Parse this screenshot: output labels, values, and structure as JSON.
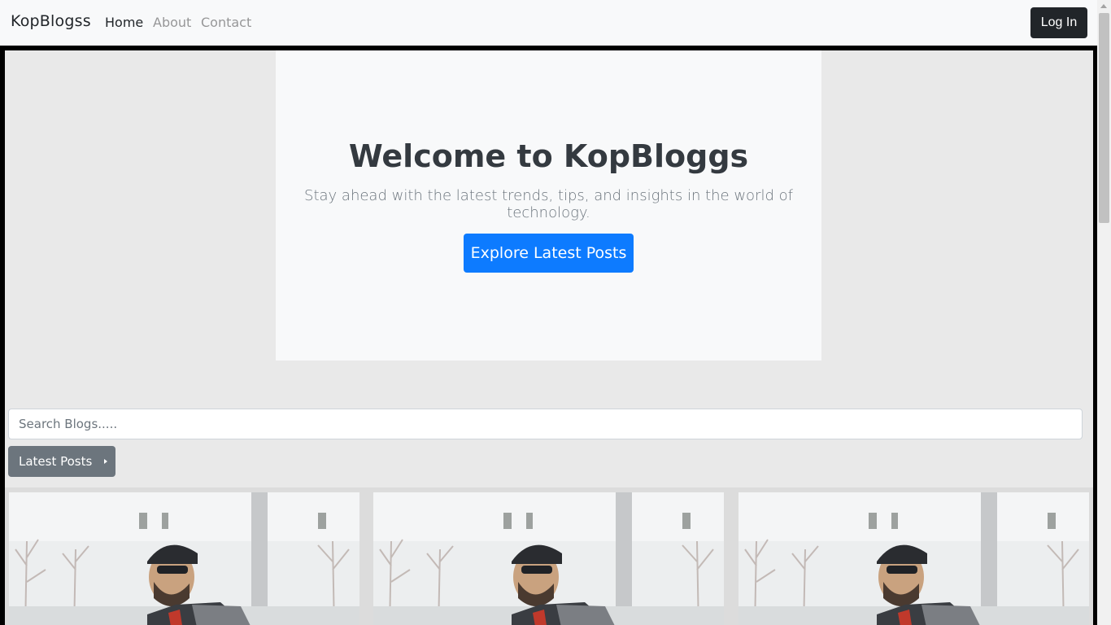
{
  "navbar": {
    "brand": "KopBlogss",
    "links": [
      {
        "label": "Home",
        "active": true
      },
      {
        "label": "About",
        "active": false
      },
      {
        "label": "Contact",
        "active": false
      }
    ],
    "login_label": "Log In"
  },
  "hero": {
    "title": "Welcome to KopBloggs",
    "subtitle": "Stay ahead with the latest trends, tips, and insights in the world of technology.",
    "cta_label": "Explore Latest Posts"
  },
  "search": {
    "placeholder": "Search Blogs....."
  },
  "latest": {
    "label": "Latest Posts"
  },
  "cards": [
    {
      "image": "man-with-cap-and-backpack-photo"
    },
    {
      "image": "man-with-cap-and-backpack-photo"
    },
    {
      "image": "man-with-cap-and-backpack-photo"
    }
  ],
  "colors": {
    "primary": "#0d7bff",
    "dark": "#212529",
    "secondary": "#6c757d",
    "page_bg": "#e9e9e9"
  }
}
